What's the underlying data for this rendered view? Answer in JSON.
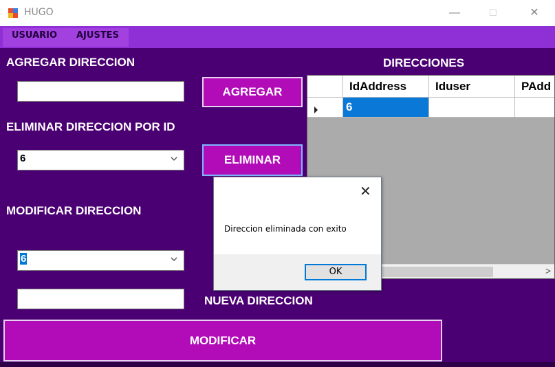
{
  "window": {
    "title": "HUGO",
    "minimize": "—",
    "maximize": "☐",
    "close": "✕"
  },
  "menu": {
    "items": [
      "USUARIO",
      "AJUSTES"
    ]
  },
  "agregar": {
    "section_label": "AGREGAR DIRECCION",
    "input_value": "",
    "button_label": "AGREGAR"
  },
  "eliminar": {
    "section_label": "ELIMINAR DIRECCION POR ID",
    "combo_value": "6",
    "button_label": "ELIMINAR"
  },
  "modificar": {
    "section_label": "MODIFICAR DIRECCION",
    "combo_value": "6",
    "input_value": "",
    "new_label": "NUEVA DIRECCION",
    "button_label": "MODIFICAR"
  },
  "grid": {
    "title": "DIRECCIONES",
    "columns": [
      "IdAddress",
      "Iduser",
      "PAdd"
    ],
    "rows": [
      [
        "6",
        "",
        ""
      ]
    ]
  },
  "dialog": {
    "message": "Direccion eliminada con exito",
    "ok_label": "OK",
    "close_glyph": "✕"
  },
  "colors": {
    "background": "#4a0072",
    "menubar": "#8f2fd6",
    "button": "#b10cb8",
    "selection": "#0078d7"
  }
}
